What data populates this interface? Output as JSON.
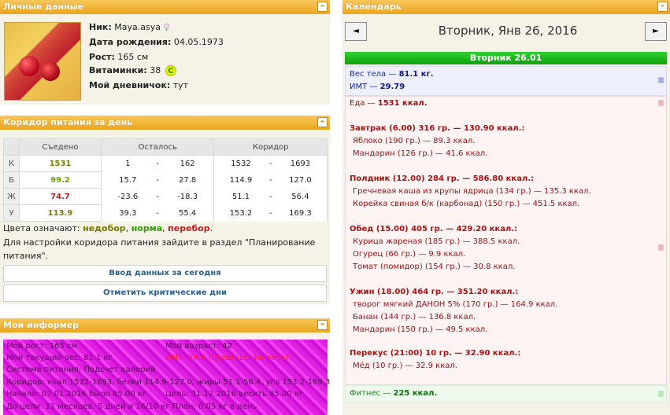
{
  "personal": {
    "title": "Личные данные",
    "nick_label": "Ник:",
    "nick": "Maya.asya",
    "birth_label": "Дата рождения:",
    "birth": "04.05.1973",
    "height_label": "Рост:",
    "height": "165 см",
    "vitamins_label": "Витаминки:",
    "vitamins": "38",
    "vitamin_badge": "C",
    "diary_label": "Мой дневничок:",
    "diary": "тут"
  },
  "corridor": {
    "title": "Коридор питания за день",
    "headers": [
      "Съедено",
      "Осталось",
      "Коридор"
    ],
    "rows": [
      {
        "label": "К",
        "eaten": "1531",
        "left_min": "1",
        "left_max": "162",
        "cor_min": "1532",
        "cor_max": "1693"
      },
      {
        "label": "Б",
        "eaten": "99.2",
        "left_min": "15.7",
        "left_max": "27.8",
        "cor_min": "114.9",
        "cor_max": "127.0"
      },
      {
        "label": "Ж",
        "eaten": "74.7",
        "left_min": "-23.6",
        "left_max": "-18.3",
        "cor_min": "51.1",
        "cor_max": "56.4"
      },
      {
        "label": "У",
        "eaten": "113.9",
        "left_min": "39.3",
        "left_max": "55.4",
        "cor_min": "153.2",
        "cor_max": "169.3"
      }
    ],
    "dash": "-",
    "colors_prefix": "Цвета означают:",
    "color_under": "недобор",
    "color_norm": "норма",
    "color_over": "перебор",
    "settings_note_1": "Для настройки коридора питания зайдите в раздел \"Планирование",
    "settings_note_2": "питания\".",
    "btn_enter": "Ввод данных за сегодня",
    "btn_critical": "Отметить критические дни"
  },
  "informer": {
    "title": "Мой информер",
    "height": "Мой рост: 165 см",
    "age": "Мой возраст: 42",
    "weight": "Мой текущий вес: 81.1 кг",
    "bmi": "ИМТ: 29.8 (превышение веса)",
    "system": "Система питания: Подсчет калорий",
    "corridor": "Коридор: ккал 1532-1693, белки 114.9-127.0, жиры 51.1-56.4, угл 153.2-169.3",
    "start": "Начало: 07.01.2016 было 85.00 кг",
    "goal": "Цель: 31.12.2016 весить 85.00 кг",
    "until": "До цели: 11 месяцев, 5 дней и 16/10 кг План: 0.05 кг в день"
  },
  "calendar": {
    "title": "Календарь",
    "prev": "◄",
    "next": "►",
    "date": "Вторник, Янв 26, 2016",
    "day_bar": "Вторник 26.01",
    "weight_label": "Вес тела —",
    "weight_value": "81.1 кг.",
    "bmi_label": "ИМТ —",
    "bmi_value": "29.79",
    "food_label": "Еда —",
    "food_value": "1531 ккал.",
    "meals": [
      {
        "header": "Завтрак (6.00) 316 гр. — 130.90 ккал.:",
        "items": [
          "Яблоко (190 гр.) — 89.3 ккал.",
          "Мандарин (126 гр.) — 41.6 ккал."
        ]
      },
      {
        "header": "Полдник (12.00) 284 гр. — 586.80 ккал.:",
        "items": [
          "Гречневая каша из крупы ядрица (134 гр.) — 135.3 ккал.",
          "Корейка свиная б/к (карбонад) (150 гр.) — 451.5 ккал."
        ]
      },
      {
        "header": "Обед (15.00) 405 гр. — 429.20 ккал.:",
        "items": [
          "Курица жареная (185 гр.) — 388.5 ккал.",
          "Огурец (66 гр.) — 9.9 ккал.",
          "Томат (помидор) (154 гр.) — 30.8 ккал."
        ]
      },
      {
        "header": "Ужин (18.00) 464 гр. — 351.20 ккал.:",
        "items": [
          "творог мягкий ДАНОН 5% (170 гр.) — 164.9 ккал.",
          "Банан (144 гр.) — 136.8 ккал.",
          "Мандарин (150 гр.) — 49.5 ккал."
        ]
      },
      {
        "header": "Перекус (21:00) 10 гр. — 32.90 ккал.:",
        "items": [
          "Мёд (10 гр.) — 32.9 ккал."
        ]
      }
    ],
    "fitness_label": "Фитнес —",
    "fitness_value": "225 ккал."
  }
}
